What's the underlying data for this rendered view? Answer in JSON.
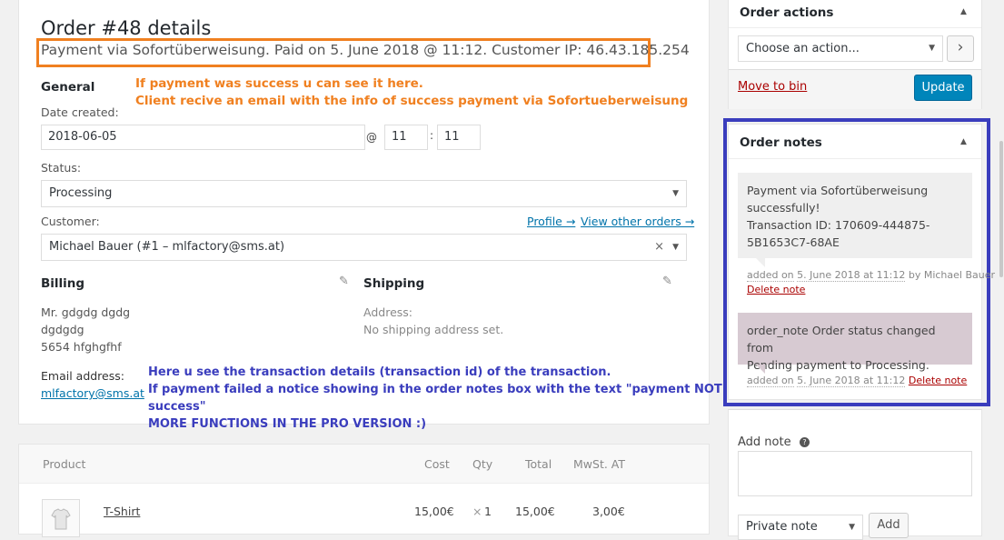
{
  "order": {
    "title": "Order #48 details",
    "payment_line": "Payment via Sofortüberweisung. Paid on 5. June 2018 @ 11:12. Customer IP: 46.43.185.254"
  },
  "annotations": {
    "orange_1": "If payment was success u can see it here.",
    "orange_2": "Client recive an email with the info of success payment via Sofortueberweisung",
    "blue_1": "Here u see the transaction details (transaction id) of the transaction.",
    "blue_2": "If payment failed a notice showing in the order notes box with the text \"payment NOT",
    "blue_3": "success\"",
    "blue_4": "MORE FUNCTIONS IN THE PRO VERSION :)"
  },
  "general": {
    "heading": "General",
    "date_label": "Date created:",
    "date_value": "2018-06-05",
    "at": "@",
    "hour": "11",
    "colon": ":",
    "minute": "11",
    "status_label": "Status:",
    "status_value": "Processing",
    "customer_label": "Customer:",
    "profile_link": "Profile →",
    "view_orders_link": "View other orders →",
    "customer_value": "Michael Bauer (#1 – mlfactory@sms.at)",
    "clear": "×"
  },
  "billing": {
    "heading": "Billing",
    "line1": "Mr. gdgdg dgdg",
    "line2": "dgdgdg",
    "line3": "5654 hfghgfhf",
    "email_label": "Email address:",
    "email_value": "mlfactory@sms.at"
  },
  "shipping": {
    "heading": "Shipping",
    "address_label": "Address:",
    "address_value": "No shipping address set."
  },
  "items_table": {
    "headers": {
      "product": "Product",
      "cost": "Cost",
      "qty": "Qty",
      "total": "Total",
      "tax": "MwSt. AT"
    },
    "row": {
      "name": "T-Shirt",
      "cost": "15,00€",
      "qty_x": "×",
      "qty": "1",
      "total": "15,00€",
      "tax": "3,00€"
    }
  },
  "order_actions": {
    "title": "Order actions",
    "select_value": "Choose an action...",
    "go": "›",
    "move_to_bin": "Move to bin",
    "update": "Update"
  },
  "order_notes": {
    "title": "Order notes",
    "note1": {
      "line1": "Payment via Sofortüberweisung",
      "line2": "successfully!",
      "line3": "Transaction ID: 170609-444875-",
      "line4": "5B1653C7-68AE",
      "meta_prefix": "added on",
      "meta_date": "5. June 2018 at 11:12",
      "meta_by": "by Michael Bauer",
      "delete": "Delete note"
    },
    "note2": {
      "line1": "order_note Order status changed from",
      "line2": "Pending payment to Processing.",
      "meta_prefix": "added on",
      "meta_date": "5. June 2018 at 11:12",
      "delete": "Delete note"
    }
  },
  "add_note": {
    "label": "Add note",
    "help": "?",
    "type_value": "Private note",
    "add_button": "Add"
  },
  "colors": {
    "accent": "#0073aa",
    "orange": "#f08020",
    "blue_frame": "#3a3dbd",
    "update_btn": "#0085ba"
  }
}
